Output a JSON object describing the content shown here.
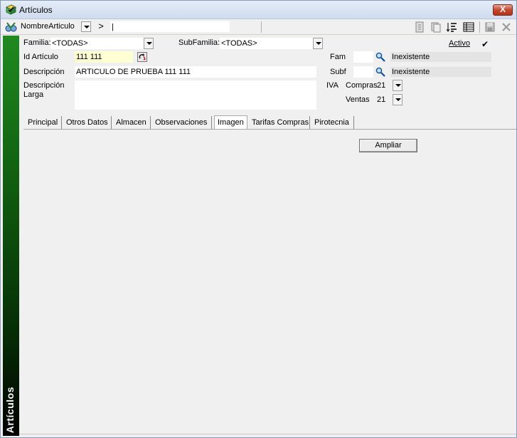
{
  "window": {
    "title": "Artículos",
    "close_label": "X"
  },
  "toolbar": {
    "field_selector": "NombreArticulo",
    "go_label": ">",
    "search_value": "|"
  },
  "sidebar": {
    "label": "Artículos"
  },
  "form": {
    "familia_label": "Familia:",
    "familia_value": "<TODAS>",
    "subfamilia_label": "SubFamilia:",
    "subfamilia_value": "<TODAS>",
    "activo_label": "Activo",
    "activo_check": "✔",
    "id_label": "Id Artículo",
    "id_value": "111 111",
    "descripcion_label": "Descripción",
    "descripcion_value": "ARTICULO DE PRUEBA 111 111",
    "descripcion_larga_label": "Descripción Larga",
    "fam_label": "Fam",
    "fam_status": "Inexistente",
    "subf_label": "Subf",
    "subf_status": "Inexistente",
    "iva_label": "IVA",
    "compras_label": "Compras",
    "compras_value": "21",
    "ventas_label": "Ventas",
    "ventas_value": "21"
  },
  "tabs": [
    {
      "label": "Principal"
    },
    {
      "label": "Otros Datos"
    },
    {
      "label": "Almacen"
    },
    {
      "label": "Observaciones"
    },
    {
      "label": "Imagen"
    },
    {
      "label": "Tarifas Compras"
    },
    {
      "label": "Pirotecnia"
    }
  ],
  "panel": {
    "ampliar_label": "Ampliar"
  }
}
